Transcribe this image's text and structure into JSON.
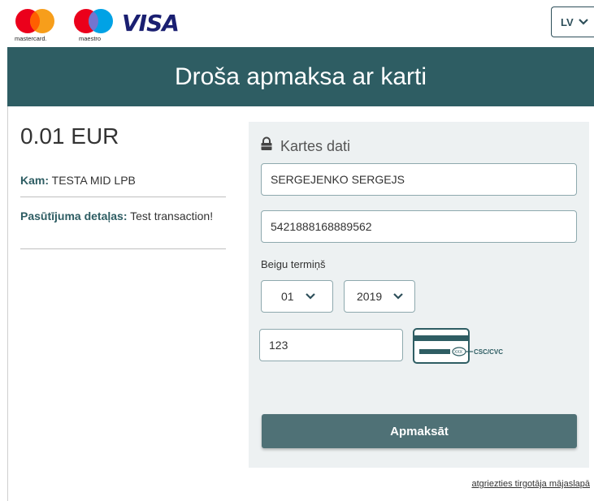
{
  "brands": {
    "mastercard_label": "mastercard.",
    "maestro_label": "maestro",
    "visa_label": "VISA"
  },
  "language": {
    "selected": "LV",
    "icon": "chevron-down-icon"
  },
  "header": {
    "title": "Droša apmaksa ar karti"
  },
  "order": {
    "amount": "0.01 EUR",
    "recipient_label": "Kam:",
    "recipient_value": "TESTA MID LPB",
    "details_label": "Pasūtījuma detaļas:",
    "details_value": "Test transaction!"
  },
  "card_form": {
    "title": "Kartes dati",
    "title_icon": "lock-icon",
    "cardholder_value": "SERGEJENKO SERGEJS",
    "card_number_value": "5421888168889562",
    "expiry_label": "Beigu termiņš",
    "expiry_month": "01",
    "expiry_year": "2019",
    "cvc_value": "123",
    "cvc_hint_label": "CSC/CVC",
    "cvc_hint_code": "XXX",
    "pay_button": "Apmaksāt"
  },
  "footer": {
    "back_link": "atgriezties tirgotāja mājaslapā"
  },
  "colors": {
    "header_bg": "#2e5d63",
    "panel_bg": "#edf1f2",
    "button_bg": "#4f7176",
    "visa": "#1a1f71"
  }
}
